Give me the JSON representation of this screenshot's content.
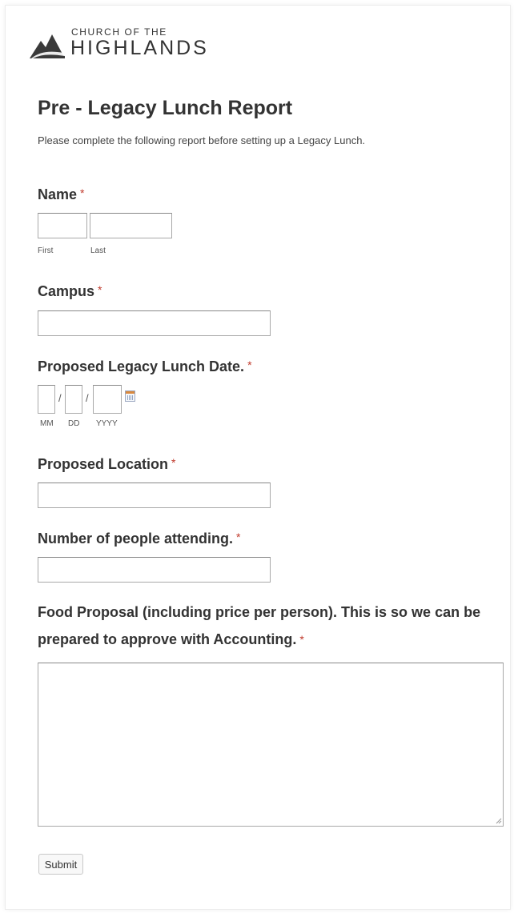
{
  "brand": {
    "line1": "CHURCH OF THE",
    "line2": "HIGHLANDS"
  },
  "form": {
    "title": "Pre - Legacy Lunch Report",
    "description": "Please complete the following report before setting up a Legacy Lunch.",
    "required_marker": "*",
    "name": {
      "label": "Name",
      "first_sublabel": "First",
      "last_sublabel": "Last",
      "first_value": "",
      "last_value": ""
    },
    "campus": {
      "label": "Campus",
      "value": ""
    },
    "date": {
      "label": "Proposed Legacy Lunch Date.",
      "separator": "/",
      "mm_sublabel": "MM",
      "dd_sublabel": "DD",
      "yyyy_sublabel": "YYYY",
      "calendar_icon": "calendar-icon"
    },
    "location": {
      "label": "Proposed Location",
      "value": ""
    },
    "attendees": {
      "label": "Number of people attending.",
      "value": ""
    },
    "food": {
      "label": "Food Proposal (including price per person). This is so we can be prepared to approve with Accounting.",
      "value": ""
    },
    "submit_label": "Submit"
  },
  "colors": {
    "required": "#c0392b",
    "text": "#333333",
    "border": "#a9a9a9"
  }
}
